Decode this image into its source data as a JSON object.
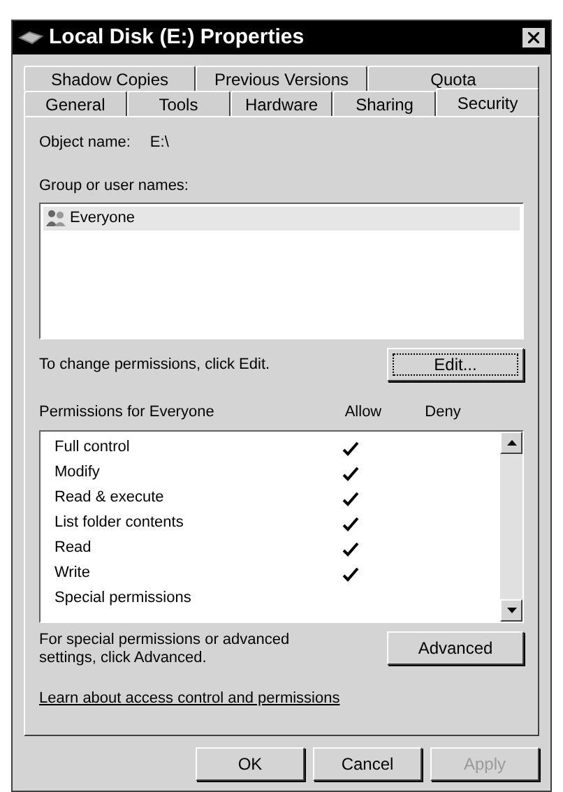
{
  "window": {
    "title": "Local Disk (E:) Properties"
  },
  "tab_rows": [
    [
      {
        "label": "Shadow Copies",
        "selected": false
      },
      {
        "label": "Previous Versions",
        "selected": false
      },
      {
        "label": "Quota",
        "selected": false
      }
    ],
    [
      {
        "label": "General",
        "selected": false
      },
      {
        "label": "Tools",
        "selected": false
      },
      {
        "label": "Hardware",
        "selected": false
      },
      {
        "label": "Sharing",
        "selected": false
      },
      {
        "label": "Security",
        "selected": true
      }
    ]
  ],
  "object_name": {
    "label": "Object name:",
    "value": "E:\\"
  },
  "group_list": {
    "label": "Group or user names:",
    "items": [
      {
        "name": "Everyone",
        "selected": true
      }
    ]
  },
  "change_hint": "To change permissions, click Edit.",
  "edit_button": "Edit...",
  "permissions": {
    "label": "Permissions for Everyone",
    "allow_header": "Allow",
    "deny_header": "Deny",
    "rows": [
      {
        "name": "Full control",
        "allow": true,
        "deny": false
      },
      {
        "name": "Modify",
        "allow": true,
        "deny": false
      },
      {
        "name": "Read & execute",
        "allow": true,
        "deny": false
      },
      {
        "name": "List folder contents",
        "allow": true,
        "deny": false
      },
      {
        "name": "Read",
        "allow": true,
        "deny": false
      },
      {
        "name": "Write",
        "allow": true,
        "deny": false
      },
      {
        "name": "Special permissions",
        "allow": false,
        "deny": false
      }
    ]
  },
  "advanced_hint": "For special permissions or advanced settings, click Advanced.",
  "advanced_button": "Advanced",
  "learn_link": "Learn about access control and permissions",
  "buttons": [
    {
      "label": "OK",
      "disabled": false
    },
    {
      "label": "Cancel",
      "disabled": false
    },
    {
      "label": "Apply",
      "disabled": true
    }
  ]
}
